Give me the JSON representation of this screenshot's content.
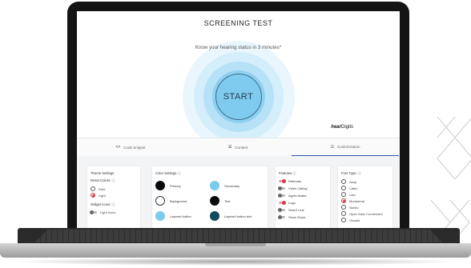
{
  "hero": {
    "title": "SCREENING TEST",
    "subtitle": "Know your hearing status in 3 minutes*",
    "start_label": "START",
    "brand_bold": "hear",
    "brand_rest": "Digits"
  },
  "tabs": [
    {
      "label": "Code Snippet",
      "icon": "code-icon",
      "glyph": "<>",
      "active": false
    },
    {
      "label": "Content",
      "icon": "content-icon",
      "glyph": "☰",
      "active": false
    },
    {
      "label": "Customization",
      "icon": "sliders-icon",
      "glyph": "☷",
      "active": true
    }
  ],
  "theme": {
    "title": "Theme Settings",
    "reset_label": "Reset Colors: ⓘ",
    "options": [
      {
        "label": "Dark",
        "selected": false
      },
      {
        "label": "Light",
        "selected": true
      }
    ],
    "widget_icons_label": "Widget Icons: ⓘ",
    "light_icons_label": "Light Icons"
  },
  "colors": {
    "title": "Color Settings ⓘ",
    "items": [
      {
        "label": "Primary",
        "color": "#0a0a0a"
      },
      {
        "label": "Secondary",
        "color": "#7ccaee"
      },
      {
        "label": "Background",
        "color": "#ffffff"
      },
      {
        "label": "Text",
        "color": "#0a0a0a"
      },
      {
        "label": "Layered button",
        "color": "#7ccaee"
      },
      {
        "label": "Layered button text",
        "color": "#0c4a5c"
      }
    ]
  },
  "features": {
    "title": "Features ⓘ",
    "items": [
      {
        "label": "Referrals",
        "on": true
      },
      {
        "label": "Video Calling",
        "on": false
      },
      {
        "label": "Agent Avatar",
        "on": false
      },
      {
        "label": "Logo",
        "on": true
      },
      {
        "label": "SearX Link",
        "on": false
      },
      {
        "label": "Show Score",
        "on": false
      }
    ]
  },
  "fonts": {
    "title": "Font Type: ⓘ",
    "items": [
      {
        "label": "Asap",
        "selected": false
      },
      {
        "label": "Cabin",
        "selected": false
      },
      {
        "label": "Lato",
        "selected": false
      },
      {
        "label": "Montserrat",
        "selected": true
      },
      {
        "label": "Nunito",
        "selected": false
      },
      {
        "label": "Open Sans Condensed",
        "selected": false
      },
      {
        "label": "Oswald",
        "selected": false
      }
    ]
  }
}
